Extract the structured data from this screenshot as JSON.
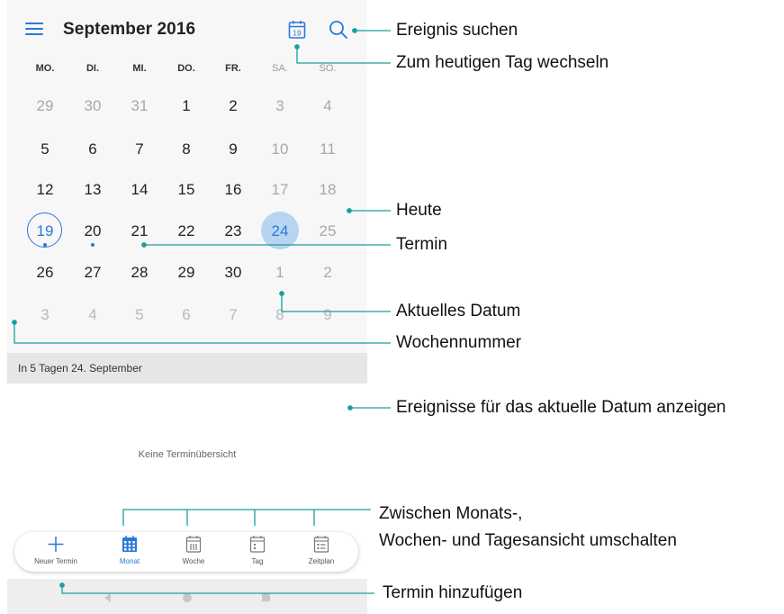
{
  "header": {
    "month_title": "September 2016",
    "today_icon_day": "19",
    "menu_icon": "hamburger-menu-icon",
    "today_icon": "calendar-today-icon",
    "search_icon": "search-icon"
  },
  "weekdays": [
    "MO.",
    "DI.",
    "MI.",
    "DO.",
    "FR.",
    "SA.",
    "SO."
  ],
  "weeks": [
    [
      "29",
      "30",
      "31",
      "1",
      "2",
      "3",
      "4"
    ],
    [
      "5",
      "6",
      "7",
      "8",
      "9",
      "10",
      "11"
    ],
    [
      "12",
      "13",
      "14",
      "15",
      "16",
      "17",
      "18"
    ],
    [
      "19",
      "20",
      "21",
      "22",
      "23",
      "24",
      "25"
    ],
    [
      "26",
      "27",
      "28",
      "29",
      "30",
      "1",
      "2"
    ],
    [
      "3",
      "4",
      "5",
      "6",
      "7",
      "8",
      "9"
    ]
  ],
  "section": {
    "label": "In 5 Tagen  24. September",
    "empty_text": "Keine Terminübersicht"
  },
  "bottom_nav": [
    {
      "label": "Neuer Termin",
      "icon": "plus-icon"
    },
    {
      "label": "Monat",
      "icon": "month-view-icon"
    },
    {
      "label": "Woche",
      "icon": "week-view-icon"
    },
    {
      "label": "Tag",
      "icon": "day-view-icon"
    },
    {
      "label": "Zeitplan",
      "icon": "schedule-view-icon"
    }
  ],
  "colors": {
    "accent": "#2a78d6",
    "selected_fill": "#b9d4f1",
    "today_ring": "#2a78d6",
    "callout": "#1a9e9e"
  },
  "annotations": {
    "search_event": "Ereignis suchen",
    "go_today": "Zum heutigen Tag wechseln",
    "today": "Heute",
    "appointment": "Termin",
    "current_date": "Aktuelles Datum",
    "week_number": "Wochennummer",
    "show_events": "Ereignisse für das aktuelle Datum anzeigen",
    "switch_view_line1": "Zwischen Monats-,",
    "switch_view_line2": "Wochen- und Tagesansicht umschalten",
    "add_appointment": "Termin hinzufügen"
  }
}
